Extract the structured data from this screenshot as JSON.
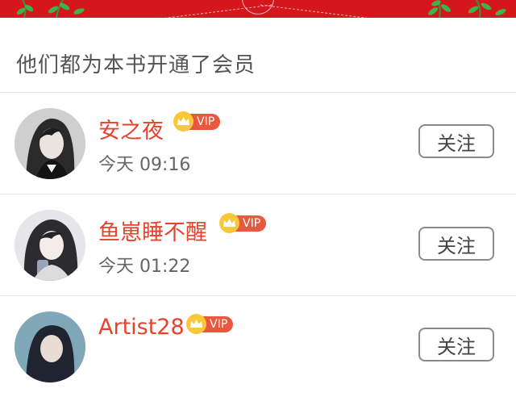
{
  "section_title": "他们都为本书开通了会员",
  "vip_label": "VIP",
  "follow_label": "关注",
  "members": [
    {
      "name": "安之夜",
      "time": "今天 09:16"
    },
    {
      "name": "鱼崽睡不醒",
      "time": "今天 01:22"
    },
    {
      "name": "Artist28",
      "time": ""
    }
  ],
  "colors": {
    "banner": "#d6161d",
    "name": "#e8412c",
    "vip_pill": "#e8583c",
    "vip_crown": "#f8c73a"
  },
  "icons": [
    "leaf-decoration-icon",
    "crown-icon"
  ]
}
